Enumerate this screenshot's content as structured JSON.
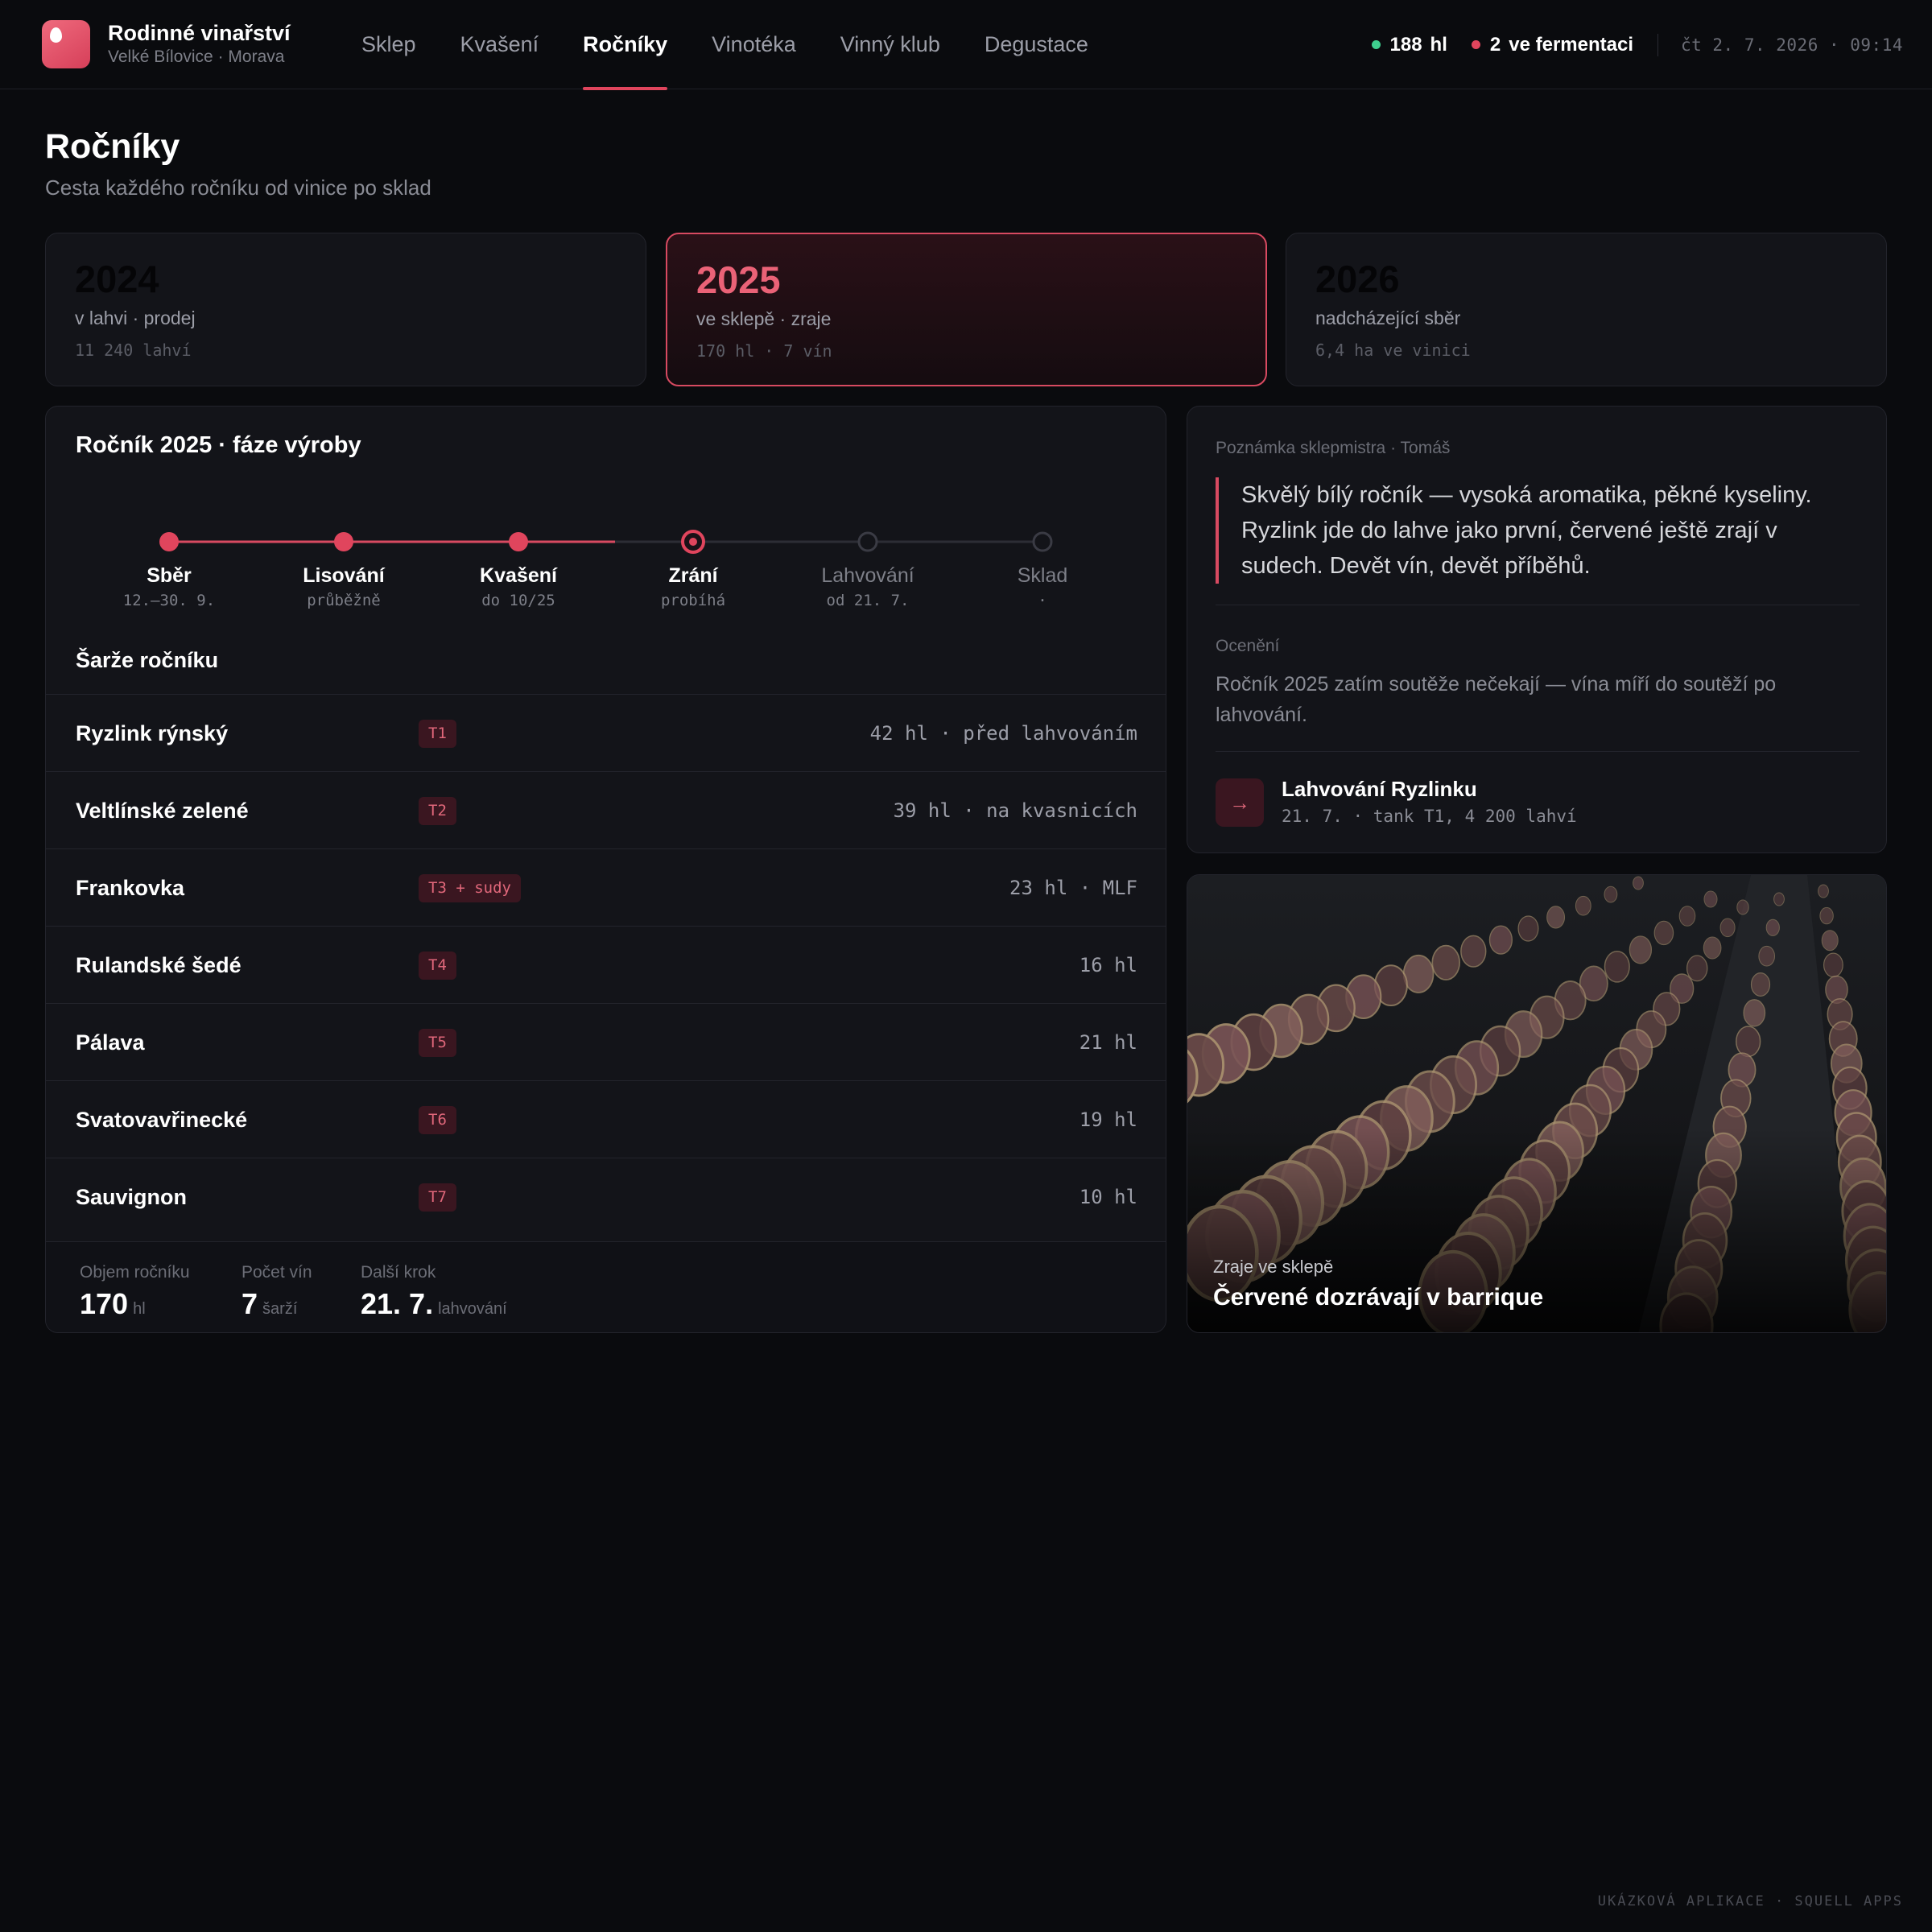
{
  "brand": {
    "name": "Rodinné vinařství",
    "location": "Velké Bílovice · Morava"
  },
  "nav": [
    {
      "label": "Sklep",
      "active": false
    },
    {
      "label": "Kvašení",
      "active": false
    },
    {
      "label": "Ročníky",
      "active": true
    },
    {
      "label": "Vinotéka",
      "active": false
    },
    {
      "label": "Vinný klub",
      "active": false
    },
    {
      "label": "Degustace",
      "active": false
    }
  ],
  "status": {
    "volume_value": "188",
    "volume_unit": "hl",
    "fermenting_count": "2",
    "fermenting_label": "ve fermentaci",
    "datetime": "čt 2. 7. 2026 · 09:14"
  },
  "page": {
    "title": "Ročníky",
    "subtitle": "Cesta každého ročníku od vinice po sklad"
  },
  "years": [
    {
      "year": "2024",
      "label": "v lahvi · prodej",
      "meta": "11 240 lahví",
      "active": false
    },
    {
      "year": "2025",
      "label": "ve sklepě · zraje",
      "meta": "170 hl · 7 vín",
      "active": true
    },
    {
      "year": "2026",
      "label": "nadcházející sběr",
      "meta": "6,4 ha ve vinici",
      "active": false
    }
  ],
  "phases": {
    "title": "Ročník 2025 · fáze výroby",
    "steps": [
      {
        "name": "Sběr",
        "date": "12.–30. 9.",
        "state": "done"
      },
      {
        "name": "Lisování",
        "date": "průběžně",
        "state": "done"
      },
      {
        "name": "Kvašení",
        "date": "do 10/25",
        "state": "done"
      },
      {
        "name": "Zrání",
        "date": "probíhá",
        "state": "current"
      },
      {
        "name": "Lahvování",
        "date": "od 21. 7.",
        "state": "future"
      },
      {
        "name": "Sklad",
        "date": "·",
        "state": "future"
      }
    ]
  },
  "batches": {
    "title": "Šarže ročníku",
    "rows": [
      {
        "name": "Ryzlink rýnský",
        "tank": "T1",
        "info": "42 hl · před lahvováním"
      },
      {
        "name": "Veltlínské zelené",
        "tank": "T2",
        "info": "39 hl · na kvasnicích"
      },
      {
        "name": "Frankovka",
        "tank": "T3 + sudy",
        "info": "23 hl · MLF"
      },
      {
        "name": "Rulandské šedé",
        "tank": "T4",
        "info": "16 hl"
      },
      {
        "name": "Pálava",
        "tank": "T5",
        "info": "21 hl"
      },
      {
        "name": "Svatovavřinecké",
        "tank": "T6",
        "info": "19 hl"
      },
      {
        "name": "Sauvignon",
        "tank": "T7",
        "info": "10 hl"
      }
    ]
  },
  "summary": [
    {
      "label": "Objem ročníku",
      "value": "170",
      "unit": "hl"
    },
    {
      "label": "Počet vín",
      "value": "7",
      "unit": "šarží"
    },
    {
      "label": "Další krok",
      "value": "21. 7.",
      "unit": "lahvování"
    }
  ],
  "note": {
    "heading": "Poznámka sklepmistra · Tomáš",
    "quote": "Skvělý bílý ročník — vysoká aromatika, pěkné kyseliny. Ryzlink jde do lahve jako první, červené ještě zrají v sudech. Devět vín, devět příběhů.",
    "awards_heading": "Ocenění",
    "awards_text": "Ročník 2025 zatím soutěže nečekají — vína míří do soutěží po lahvování.",
    "next_title": "Lahvování Ryzlinku",
    "next_meta": "21. 7. · tank T1, 4 200 lahví",
    "next_icon": "arrow-right-icon"
  },
  "image_card": {
    "subtitle": "Zraje ve sklepě",
    "title": "Červené dozrávají v barrique"
  },
  "footer": "UKÁZKOVÁ APLIKACE · SQUELL APPS",
  "colors": {
    "accent": "#e0455d",
    "ok": "#3ecf8e",
    "background": "#0a0b0e",
    "panel": "#131419"
  }
}
